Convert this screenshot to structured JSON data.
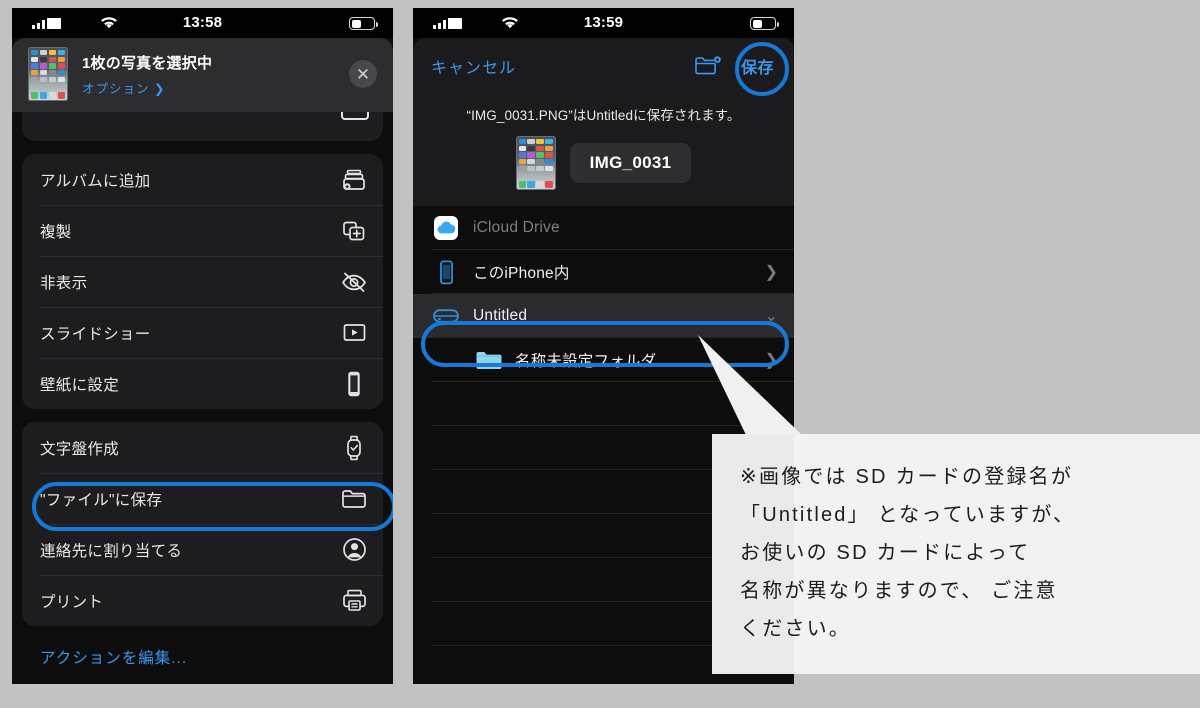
{
  "meta": {
    "bg_color": "#c2c2c2",
    "accent_blue": "#1479d8",
    "link_blue": "#3d96f0"
  },
  "left_phone": {
    "status_bar": {
      "time": "13:58",
      "signal_icon": "cellular-bars-icon",
      "wifi_icon": "wifi-icon",
      "battery_icon": "battery-icon"
    },
    "share_sheet": {
      "title": "1枚の写真を選択中",
      "subtitle": "オプション ❯",
      "close_label": "✕",
      "thumbnail_name": "photo-thumbnail"
    },
    "menu_groups": [
      {
        "items": [
          {
            "label": "アルバムに追加",
            "icon": "add-to-album-icon"
          },
          {
            "label": "複製",
            "icon": "duplicate-icon"
          },
          {
            "label": "非表示",
            "icon": "hide-eye-slash-icon"
          },
          {
            "label": "スライドショー",
            "icon": "slideshow-play-icon"
          },
          {
            "label": "壁紙に設定",
            "icon": "set-wallpaper-iphone-icon"
          }
        ]
      },
      {
        "items": [
          {
            "label": "文字盤作成",
            "icon": "watch-face-icon"
          },
          {
            "label": "\"ファイル\"に保存",
            "icon": "folder-icon",
            "highlighted": true
          },
          {
            "label": "連絡先に割り当てる",
            "icon": "contact-person-icon"
          },
          {
            "label": "プリント",
            "icon": "printer-icon"
          }
        ]
      }
    ],
    "edit_actions_label": "アクションを編集..."
  },
  "right_phone": {
    "status_bar": {
      "time": "13:59",
      "signal_icon": "cellular-bars-icon",
      "wifi_icon": "wifi-icon",
      "battery_icon": "battery-icon"
    },
    "nav": {
      "cancel_label": "キャンセル",
      "new_folder_icon": "new-folder-icon",
      "save_label": "保存",
      "save_highlighted": true
    },
    "description": "“IMG_0031.PNG”はUntitledに保存されます。",
    "file": {
      "name": "IMG_0031",
      "thumbnail_name": "photo-thumbnail"
    },
    "locations": [
      {
        "label": "iCloud Drive",
        "icon": "icloud-drive-icon",
        "dimmed": true,
        "chevron": ""
      },
      {
        "label": "このiPhone内",
        "icon": "iphone-icon",
        "dimmed": false,
        "chevron": "❯"
      },
      {
        "label": "Untitled",
        "icon": "external-drive-icon",
        "dimmed": false,
        "chevron": "⌄",
        "selected": true,
        "highlighted": true
      },
      {
        "label": "名称未設定フォルダ",
        "icon": "folder-blue-icon",
        "dimmed": false,
        "chevron": "❯",
        "indent": true
      }
    ],
    "empty_row_count": 6
  },
  "callout": {
    "text": "※画像では SD カードの登録名が\n「Untitled」 となっていますが、\n お使いの SD カードによって\n名称が異なりますので、 ご注意\nください。"
  }
}
